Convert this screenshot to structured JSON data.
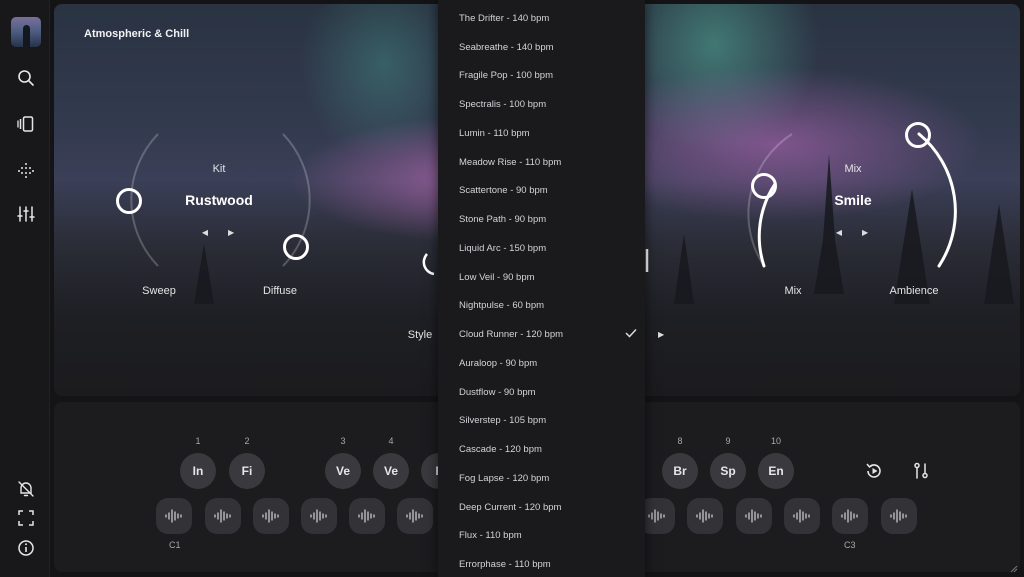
{
  "hero": {
    "title": "Atmospheric & Chill",
    "kit": {
      "caption": "Kit",
      "name": "Rustwood"
    },
    "mix": {
      "caption": "Mix",
      "name": "Smile"
    },
    "knobs": {
      "sweep": "Sweep",
      "diffuse": "Diffuse",
      "mix": "Mix",
      "ambience": "Ambience"
    },
    "style_label": "Style"
  },
  "dropdown": {
    "selected_index": 11,
    "items": [
      "The Drifter - 140 bpm",
      "Seabreathe - 140 bpm",
      "Fragile Pop - 100 bpm",
      "Spectralis - 100 bpm",
      "Lumin - 110 bpm",
      "Meadow Rise - 110 bpm",
      "Scattertone - 90 bpm",
      "Stone Path - 90 bpm",
      "Liquid Arc - 150 bpm",
      "Low Veil - 90 bpm",
      "Nightpulse - 60 bpm",
      "Cloud Runner - 120 bpm",
      "Auraloop - 90 bpm",
      "Dustflow - 90 bpm",
      "Silverstep - 105 bpm",
      "Cascade - 120 bpm",
      "Fog Lapse - 120 bpm",
      "Deep Current - 120 bpm",
      "Flux - 110 bpm",
      "Errorphase - 110 bpm"
    ]
  },
  "pads": {
    "left": [
      {
        "num": "1",
        "label": "In"
      },
      {
        "num": "2",
        "label": "Fi"
      },
      {
        "num": "3",
        "label": "Ve"
      },
      {
        "num": "4",
        "label": "Ve"
      },
      {
        "num": "",
        "label": "F"
      }
    ],
    "right": [
      {
        "num": "8",
        "label": "Br"
      },
      {
        "num": "9",
        "label": "Sp"
      },
      {
        "num": "10",
        "label": "En"
      }
    ],
    "octave_left": "C1",
    "octave_right": "C3"
  }
}
